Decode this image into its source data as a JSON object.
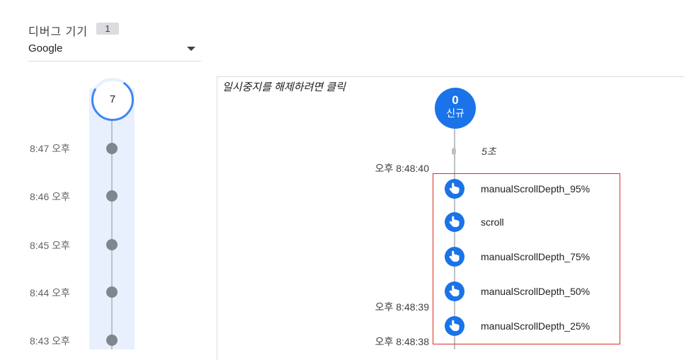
{
  "device_panel": {
    "title": "디버그 기기",
    "count": "1",
    "selected_device": "Google"
  },
  "minute_timeline": {
    "total": "7",
    "minutes": [
      {
        "label": "8:47 오후"
      },
      {
        "label": "8:46 오후"
      },
      {
        "label": "8:45 오후"
      },
      {
        "label": "8:44 오후"
      },
      {
        "label": "8:43 오후"
      }
    ]
  },
  "event_stream": {
    "pause_hint": "일시중지를 해제하려면 클릭",
    "session": {
      "count": "0",
      "label": "신규"
    },
    "gap_label": "5초",
    "timestamps": [
      "오후 8:48:40",
      "오후 8:48:39",
      "오후 8:48:38"
    ],
    "events": [
      {
        "name": "manualScrollDepth_95%",
        "icon": "touch-icon"
      },
      {
        "name": "scroll",
        "icon": "touch-icon"
      },
      {
        "name": "manualScrollDepth_75%",
        "icon": "touch-icon"
      },
      {
        "name": "manualScrollDepth_50%",
        "icon": "touch-icon"
      },
      {
        "name": "manualScrollDepth_25%",
        "icon": "touch-icon"
      }
    ]
  },
  "colors": {
    "accent": "#1a73e8",
    "ring": "#4285f4",
    "highlight_border": "#d93025",
    "timeline_band": "#e8f0fe"
  }
}
